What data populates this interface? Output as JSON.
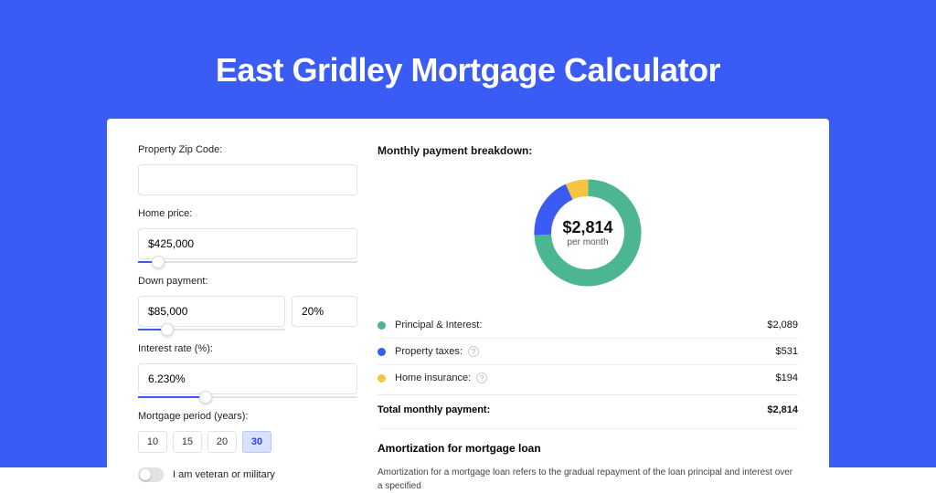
{
  "page_title": "East Gridley Mortgage Calculator",
  "form": {
    "zip_label": "Property Zip Code:",
    "zip_value": "",
    "price_label": "Home price:",
    "price_value": "$425,000",
    "price_slider_pct": 9,
    "down_label": "Down payment:",
    "down_value": "$85,000",
    "down_pct_value": "20%",
    "down_slider_pct": 20,
    "rate_label": "Interest rate (%):",
    "rate_value": "6.230%",
    "rate_slider_pct": 31,
    "period_label": "Mortgage period (years):",
    "periods": [
      "10",
      "15",
      "20",
      "30"
    ],
    "period_active_index": 3,
    "veteran_label": "I am veteran or military",
    "veteran_on": false
  },
  "breakdown": {
    "title": "Monthly payment breakdown:",
    "center_amount": "$2,814",
    "center_sub": "per month",
    "items": [
      {
        "label": "Principal & Interest:",
        "value": "$2,089",
        "color": "#4CB592",
        "help": false
      },
      {
        "label": "Property taxes:",
        "value": "$531",
        "color": "#3B5BF5",
        "help": true
      },
      {
        "label": "Home insurance:",
        "value": "$194",
        "color": "#F5C542",
        "help": true
      }
    ],
    "total_label": "Total monthly payment:",
    "total_value": "$2,814"
  },
  "amortization": {
    "title": "Amortization for mortgage loan",
    "text": "Amortization for a mortgage loan refers to the gradual repayment of the loan principal and interest over a specified"
  },
  "chart_data": {
    "type": "pie",
    "title": "Monthly payment breakdown",
    "series": [
      {
        "name": "Principal & Interest",
        "value": 2089,
        "color": "#4CB592"
      },
      {
        "name": "Property taxes",
        "value": 531,
        "color": "#3B5BF5"
      },
      {
        "name": "Home insurance",
        "value": 194,
        "color": "#F5C542"
      }
    ],
    "total": 2814,
    "center_label": "$2,814 per month"
  }
}
